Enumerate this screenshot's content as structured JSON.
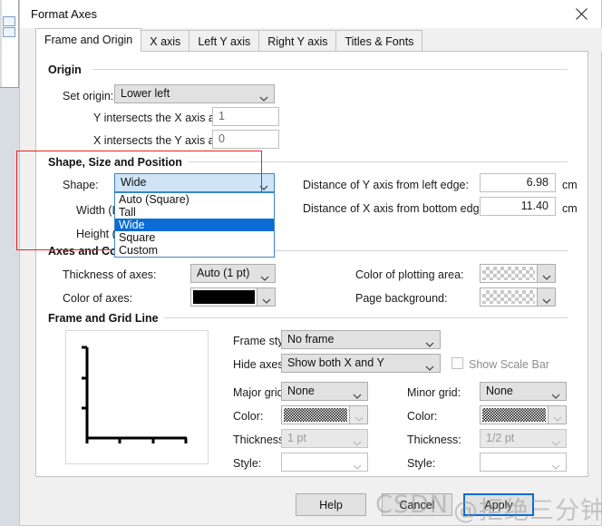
{
  "window": {
    "title": "Format Axes",
    "close_icon": "close-icon"
  },
  "tabs": [
    {
      "label": "Frame and Origin",
      "active": true
    },
    {
      "label": "X axis",
      "active": false
    },
    {
      "label": "Left Y axis",
      "active": false
    },
    {
      "label": "Right Y axis",
      "active": false
    },
    {
      "label": "Titles & Fonts",
      "active": false
    }
  ],
  "origin": {
    "group_label": "Origin",
    "set_origin_label": "Set origin:",
    "set_origin_value": "Lower left",
    "y_intersects_label": "Y intersects the X axis at X=",
    "y_intersects_value": "1",
    "x_intersects_label": "X intersects the Y axis at Y=",
    "x_intersects_value": "0"
  },
  "shape": {
    "group_label": "Shape, Size and Position",
    "shape_label": "Shape:",
    "shape_value": "Wide",
    "shape_options": [
      "Auto (Square)",
      "Tall",
      "Wide",
      "Square",
      "Custom"
    ],
    "shape_selected_option": "Wide",
    "width_label": "Width (Le",
    "height_label": "Height (L",
    "unit": "cm",
    "dist_y_label": "Distance of Y axis from left edge:",
    "dist_y_value": "6.98",
    "dist_y_unit": "cm",
    "dist_x_label": "Distance of X axis from bottom edge:",
    "dist_x_value": "11.40",
    "dist_x_unit": "cm",
    "highlight_color": "#ee2222"
  },
  "axes_colors": {
    "group_label": "Axes and Colors",
    "thickness_label": "Thickness of axes:",
    "thickness_value": "Auto (1 pt)",
    "color_axes_label": "Color of axes:",
    "color_axes_value": "#000000",
    "plot_area_label": "Color of plotting area:",
    "plot_area_value": "transparent",
    "page_bg_label": "Page background:",
    "page_bg_value": "transparent"
  },
  "frame_grid": {
    "group_label": "Frame and Grid Line",
    "frame_style_label": "Frame style:",
    "frame_style_value": "No frame",
    "hide_axes_label": "Hide axes:",
    "hide_axes_value": "Show both X and Y",
    "show_scale_bar_label": "Show Scale Bar",
    "show_scale_bar_checked": false,
    "major_grid_label": "Major grid:",
    "major_grid_value": "None",
    "major_color_label": "Color:",
    "major_thickness_label": "Thickness:",
    "major_thickness_value": "1 pt",
    "major_style_label": "Style:",
    "major_style_value": "",
    "minor_grid_label": "Minor grid:",
    "minor_grid_value": "None",
    "minor_color_label": "Color:",
    "minor_thickness_label": "Thickness:",
    "minor_thickness_value": "1/2 pt",
    "minor_style_label": "Style:",
    "minor_style_value": ""
  },
  "footer": {
    "help_label": "Help",
    "cancel_label": "Cancel",
    "apply_label": "Apply"
  },
  "watermark": {
    "text_left": "CSDN",
    "text_right": "@拒绝三分钟热度"
  }
}
